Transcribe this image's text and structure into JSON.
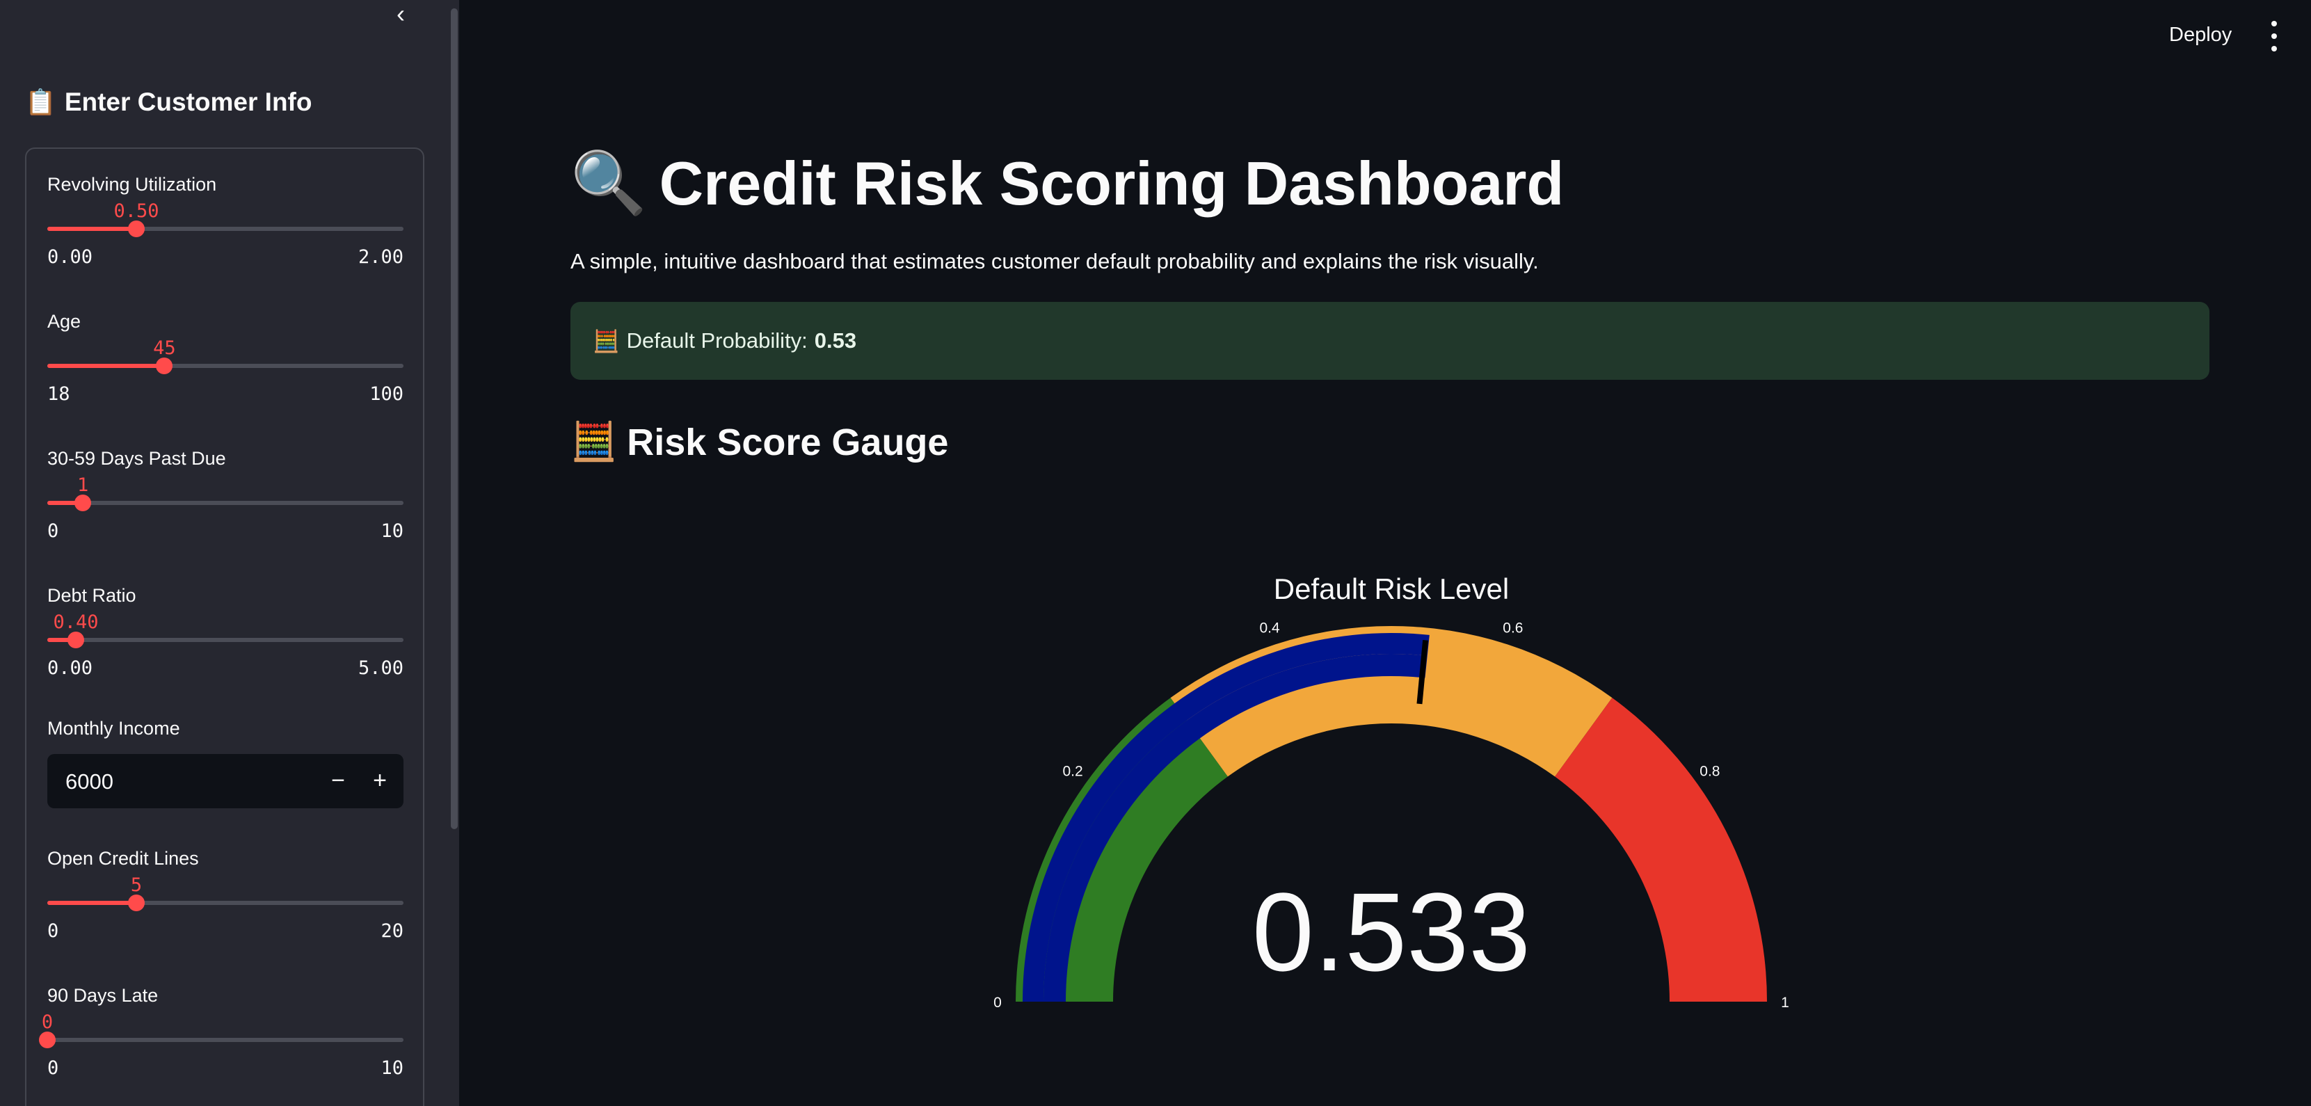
{
  "sidebar": {
    "collapse_icon": "chevron-left-icon",
    "header_icon": "clipboard-icon",
    "header": "Enter Customer Info",
    "sliders": [
      {
        "label": "Revolving Utilization",
        "value": "0.50",
        "min": "0.00",
        "max": "2.00",
        "fraction": 0.25
      },
      {
        "label": "Age",
        "value": "45",
        "min": "18",
        "max": "100",
        "fraction": 0.329
      },
      {
        "label": "30-59 Days Past Due",
        "value": "1",
        "min": "0",
        "max": "10",
        "fraction": 0.1
      },
      {
        "label": "Debt Ratio",
        "value": "0.40",
        "min": "0.00",
        "max": "5.00",
        "fraction": 0.08
      },
      {
        "label": "Open Credit Lines",
        "value": "5",
        "min": "0",
        "max": "20",
        "fraction": 0.25
      },
      {
        "label": "90 Days Late",
        "value": "0",
        "min": "0",
        "max": "10",
        "fraction": 0
      }
    ],
    "monthly_income": {
      "label": "Monthly Income",
      "value": "6000",
      "minus": "−",
      "plus": "+"
    }
  },
  "toolbar": {
    "deploy": "Deploy",
    "menu_icon": "more-vertical-icon"
  },
  "main": {
    "title_icon": "magnifier-icon",
    "title": "Credit Risk Scoring Dashboard",
    "subtitle": "A simple, intuitive dashboard that estimates customer default probability and explains the risk visually.",
    "alert": {
      "icon": "calculator-icon",
      "label": "Default Probability:",
      "value": "0.53"
    },
    "section_icon": "abacus-icon",
    "section_title": "Risk Score Gauge"
  },
  "chart_data": {
    "type": "gauge",
    "title": "Default Risk Level",
    "value": 0.533,
    "value_label": "0.533",
    "range": [
      0,
      1
    ],
    "ticks": [
      0,
      0.2,
      0.4,
      0.6,
      0.8,
      1
    ],
    "tick_labels": [
      "0",
      "0.2",
      "0.4",
      "0.6",
      "0.8",
      "1"
    ],
    "steps": [
      {
        "range": [
          0,
          0.3
        ],
        "color": "#2f7d23"
      },
      {
        "range": [
          0.3,
          0.7
        ],
        "color": "#f2a73b"
      },
      {
        "range": [
          0.7,
          1
        ],
        "color": "#e8352a"
      }
    ],
    "bar_color": "#00148c",
    "threshold": 0.53,
    "threshold_color": "#000000"
  }
}
